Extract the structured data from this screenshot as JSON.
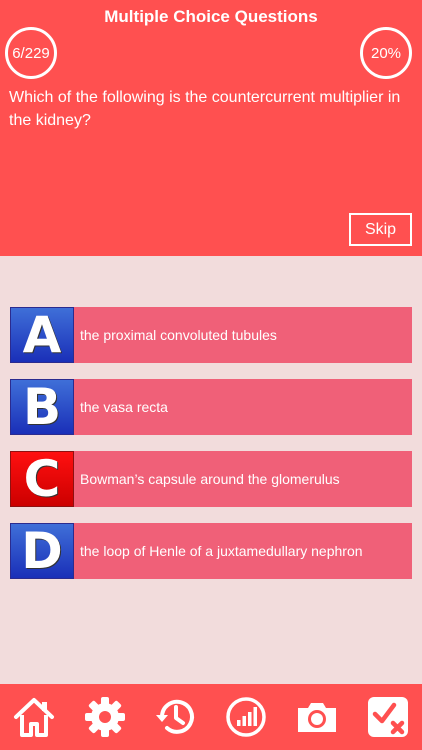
{
  "header": {
    "title": "Multiple Choice Questions",
    "progress_count": "6/229",
    "score_percent": "20%",
    "question": "Which of the following is the countercurrent multiplier in the kidney?",
    "skip_label": "Skip"
  },
  "answers": [
    {
      "letter": "A",
      "text": "the proximal convoluted tubules",
      "letter_color": "#1a2fb8"
    },
    {
      "letter": "B",
      "text": "the vasa recta",
      "letter_color": "#1a2fb8"
    },
    {
      "letter": "C",
      "text": "Bowman’s capsule around the glomerulus",
      "letter_color": "#e00000"
    },
    {
      "letter": "D",
      "text": "the loop of Henle of a juxtamedullary nephron",
      "letter_color": "#1a2fb8"
    }
  ],
  "toolbar": {
    "icons": [
      "home-icon",
      "gear-icon",
      "history-icon",
      "stats-icon",
      "camera-icon",
      "review-icon"
    ]
  },
  "colors": {
    "accent": "#ff5050",
    "answer_bg": "#f06078",
    "page_bg": "#f2dcdc"
  }
}
